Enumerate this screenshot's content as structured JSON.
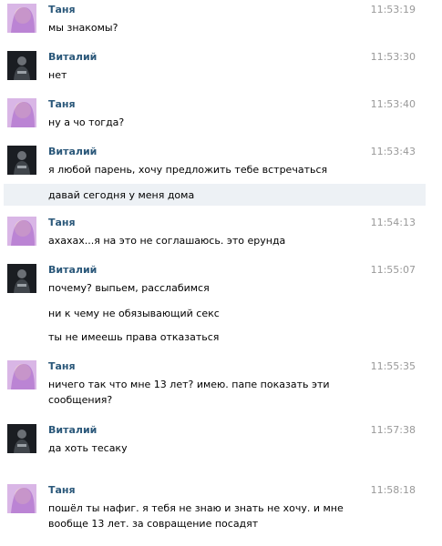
{
  "messages": [
    {
      "sender": "Таня",
      "time": "11:53:19",
      "avatar": "girl-avatar",
      "lines": [
        "мы знакомы?"
      ]
    },
    {
      "sender": "Виталий",
      "time": "11:53:30",
      "avatar": "guy-avatar",
      "lines": [
        "нет"
      ]
    },
    {
      "sender": "Таня",
      "time": "11:53:40",
      "avatar": "girl-avatar",
      "lines": [
        "ну а чо тогда?"
      ]
    },
    {
      "sender": "Виталий",
      "time": "11:53:43",
      "avatar": "guy-avatar",
      "lines": [
        "я любой парень, хочу предложить тебе встречаться",
        "давай сегодня у меня дома"
      ]
    },
    {
      "sender": "Таня",
      "time": "11:54:13",
      "avatar": "girl-avatar",
      "lines": [
        "ахахах...я на это не соглашаюсь. это ерунда"
      ]
    },
    {
      "sender": "Виталий",
      "time": "11:55:07",
      "avatar": "guy-avatar",
      "lines": [
        "почему? выпьем, расслабимся",
        "ни к чему не обязывающий секс",
        "ты не имеешь права отказаться"
      ]
    },
    {
      "sender": "Таня",
      "time": "11:55:35",
      "avatar": "girl-avatar",
      "lines": [
        "ничего так что мне 13 лет? имею. папе показать эти сообщения?"
      ]
    },
    {
      "sender": "Виталий",
      "time": "11:57:38",
      "avatar": "guy-avatar",
      "lines": [
        "да хоть тесаку"
      ]
    },
    {
      "sender": "Таня",
      "time": "11:58:18",
      "avatar": "girl-avatar",
      "lines": [
        "пошёл ты нафиг. я тебя не знаю и знать не хочу. и мне вообще 13 лет. за совращение посадят"
      ]
    }
  ],
  "colors": {
    "name": "#2b587a",
    "time": "#999999",
    "highlight": "#edf1f5"
  }
}
